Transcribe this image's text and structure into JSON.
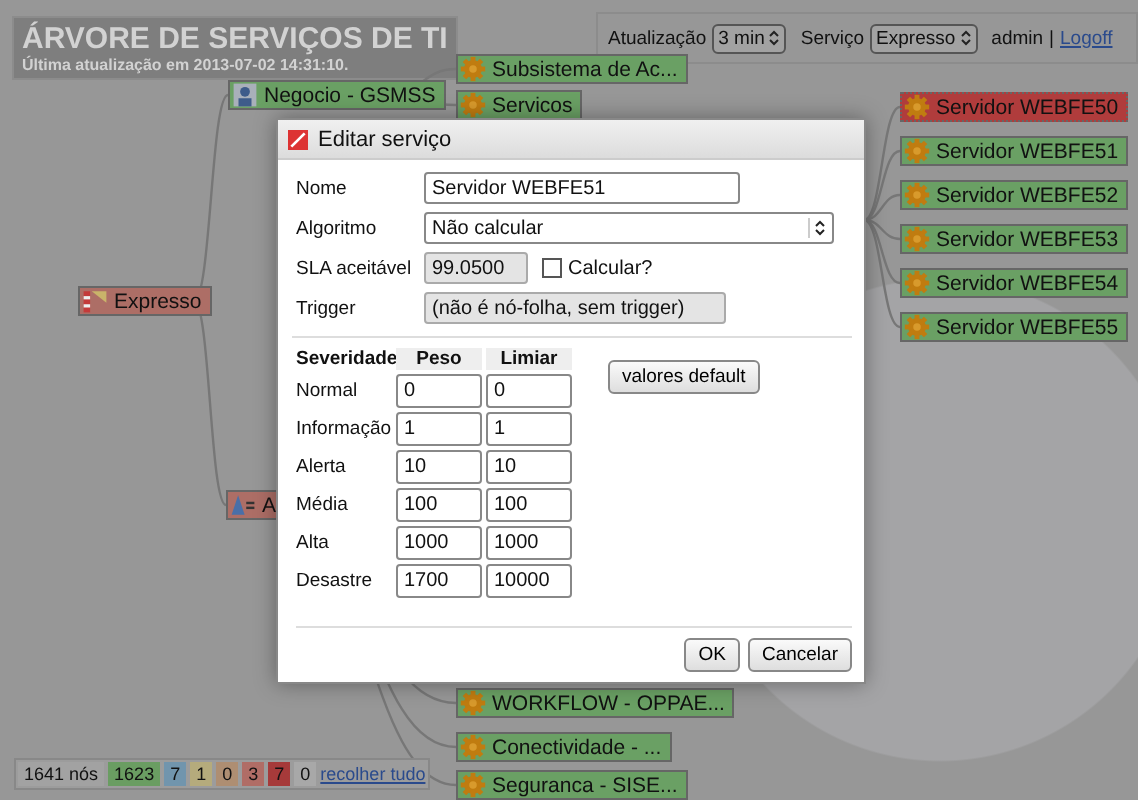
{
  "header": {
    "title": "ÁRVORE DE SERVIÇOS DE TI",
    "subtitle": "Última atualização em 2013-07-02 14:31:10."
  },
  "controls": {
    "refresh_label": "Atualização",
    "refresh_value": "3 min",
    "service_label": "Serviço",
    "service_value": "Expresso",
    "user": "admin",
    "separator": "|",
    "logout": "Logoff"
  },
  "tree_nodes": [
    {
      "label": "Expresso",
      "color": "#ad6e66"
    },
    {
      "label": "Negocio - GSMSS",
      "color": "#6aa064"
    },
    {
      "label": "A",
      "color": "#ad6e66"
    },
    {
      "label": "Subsistema de Ac...",
      "color": "#6aa064"
    },
    {
      "label": "Servicos",
      "color": "#6aa064"
    },
    {
      "label": "WORKFLOW - OPPAE...",
      "color": "#6aa064"
    },
    {
      "label": "Conectividade - ...",
      "color": "#6aa064"
    },
    {
      "label": "Seguranca - SISE...",
      "color": "#6aa064"
    },
    {
      "label": "Servidor WEBFE50",
      "color": "#b03c3c"
    },
    {
      "label": "Servidor WEBFE51",
      "color": "#6aa064"
    },
    {
      "label": "Servidor WEBFE52",
      "color": "#6aa064"
    },
    {
      "label": "Servidor WEBFE53",
      "color": "#6aa064"
    },
    {
      "label": "Servidor WEBFE54",
      "color": "#6aa064"
    },
    {
      "label": "Servidor WEBFE55",
      "color": "#6aa064"
    }
  ],
  "summary": {
    "total": "1641 nós",
    "counts": [
      {
        "value": "1623",
        "color": "#6a9d62"
      },
      {
        "value": "7",
        "color": "#7195ad"
      },
      {
        "value": "1",
        "color": "#b5ab7c"
      },
      {
        "value": "0",
        "color": "#ae8e72"
      },
      {
        "value": "3",
        "color": "#b06d66"
      },
      {
        "value": "7",
        "color": "#a63a3a"
      },
      {
        "value": "0",
        "color": "#a8a8a8"
      }
    ],
    "collapse_link": "recolher tudo"
  },
  "dialog": {
    "title": "Editar serviço",
    "fields": [
      {
        "kind": "text",
        "label": "Nome",
        "value": "Servidor WEBFE51",
        "disabled": false
      },
      {
        "kind": "select",
        "label": "Algoritmo",
        "value": "Não calcular",
        "disabled": false
      },
      {
        "kind": "sla",
        "label": "SLA aceitável",
        "value": "99.0500",
        "disabled": true,
        "check_label": "Calcular?",
        "checked": false
      },
      {
        "kind": "text",
        "label": "Trigger",
        "value": "(não é nó-folha, sem trigger)",
        "disabled": true
      }
    ],
    "severity_table": {
      "columns": [
        "Severidade",
        "Peso",
        "Limiar"
      ],
      "rows": [
        {
          "name": "Normal",
          "weight": "0",
          "threshold": "0"
        },
        {
          "name": "Informação",
          "weight": "1",
          "threshold": "1"
        },
        {
          "name": "Alerta",
          "weight": "10",
          "threshold": "10"
        },
        {
          "name": "Média",
          "weight": "100",
          "threshold": "100"
        },
        {
          "name": "Alta",
          "weight": "1000",
          "threshold": "1000"
        },
        {
          "name": "Desastre",
          "weight": "1700",
          "threshold": "10000"
        }
      ]
    },
    "defaults_button": "valores default",
    "buttons": [
      "OK",
      "Cancelar"
    ]
  }
}
